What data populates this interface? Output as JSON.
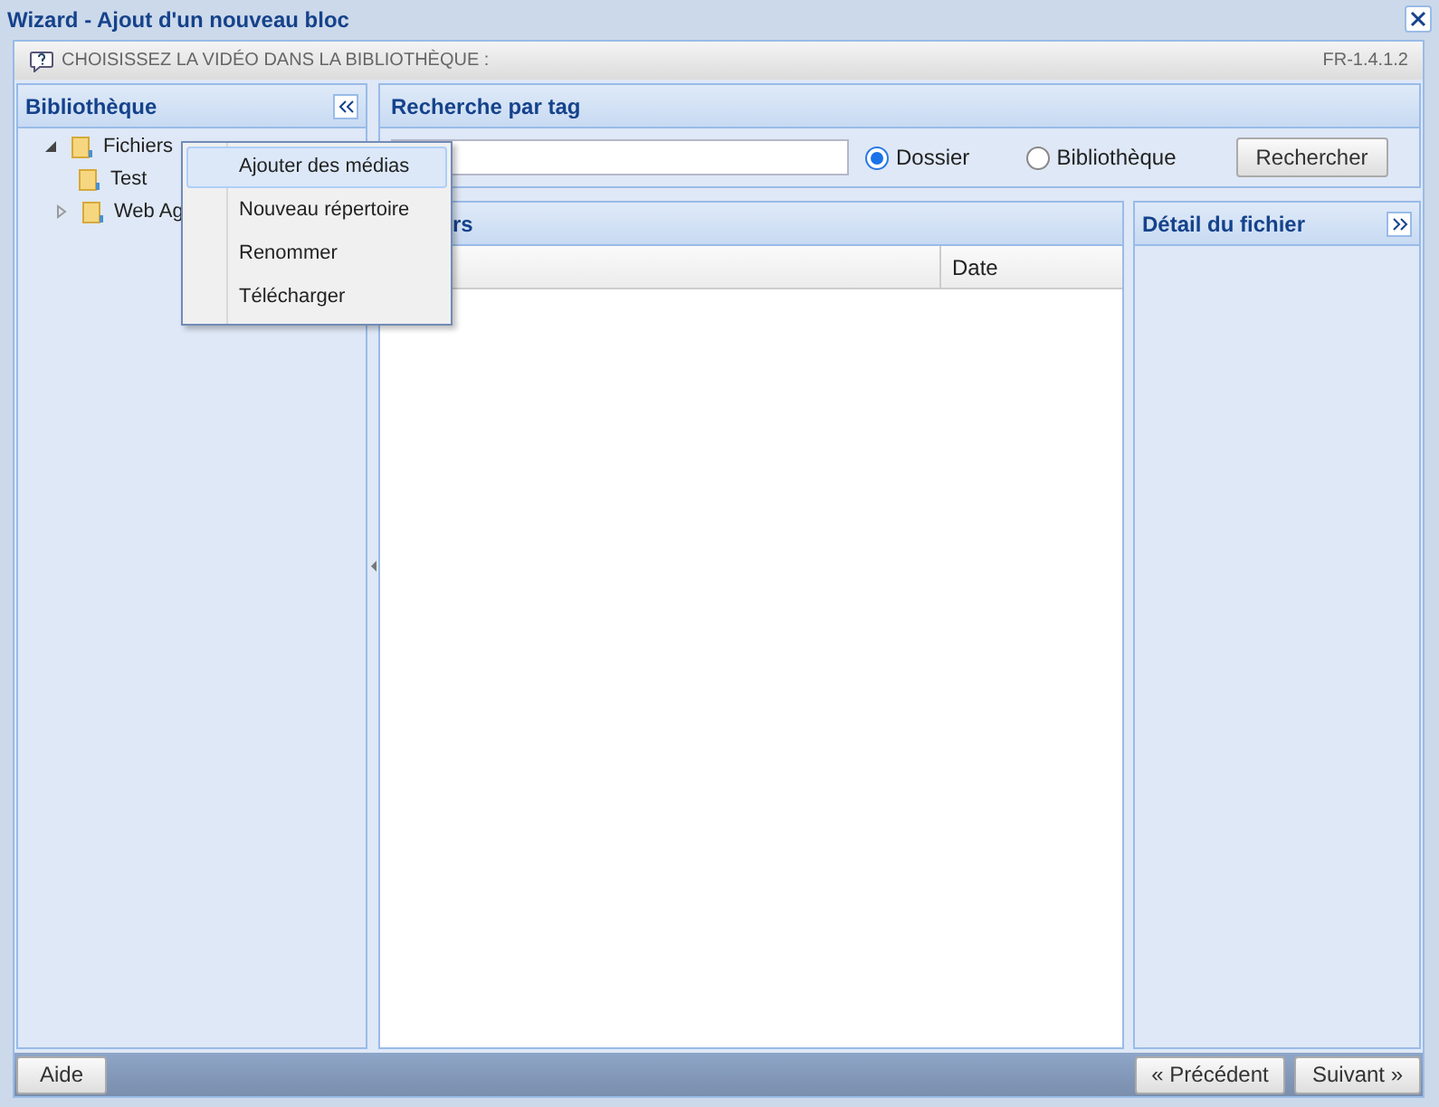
{
  "window": {
    "title": "Wizard - Ajout d'un nouveau bloc"
  },
  "info_bar": {
    "message": "CHOISISSEZ LA VIDÉO DANS LA BIBLIOTHÈQUE :",
    "version": "FR-1.4.1.2"
  },
  "library": {
    "title": "Bibliothèque",
    "tree": [
      {
        "label": "Fichiers",
        "expanded": true,
        "children": [
          {
            "label": "Test"
          },
          {
            "label": "Web Ag",
            "expanded": false
          }
        ]
      }
    ]
  },
  "context_menu": [
    {
      "label": "Ajouter des médias",
      "selected": true
    },
    {
      "label": "Nouveau répertoire",
      "selected": false
    },
    {
      "label": "Renommer",
      "selected": false
    },
    {
      "label": "Télécharger",
      "selected": false
    }
  ],
  "search": {
    "title": "Recherche par tag",
    "options": [
      {
        "label": "Dossier",
        "selected": true
      },
      {
        "label": "Bibliothèque",
        "selected": false
      }
    ],
    "button": "Rechercher"
  },
  "files": {
    "title": "rs",
    "columns": [
      "Date"
    ]
  },
  "detail": {
    "title": "Détail du fichier"
  },
  "footer": {
    "help": "Aide",
    "previous": "« Précédent",
    "next": "Suivant »"
  }
}
